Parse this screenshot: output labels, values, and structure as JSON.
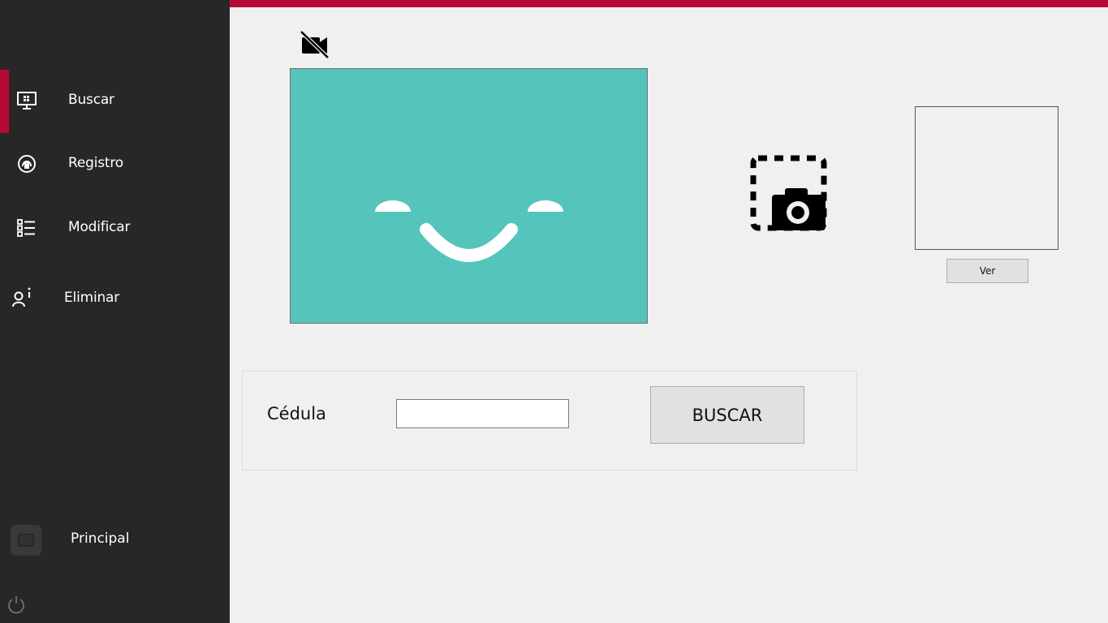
{
  "sidebar": {
    "items": [
      {
        "label": "Buscar",
        "icon": "monitor-icon",
        "active": true
      },
      {
        "label": "Registro",
        "icon": "fingerprint-icon",
        "active": false
      },
      {
        "label": "Modificar",
        "icon": "list-icon",
        "active": false
      },
      {
        "label": "Eliminar",
        "icon": "user-info-icon",
        "active": false
      }
    ],
    "principal_label": "Principal",
    "power_icon": "power-icon"
  },
  "colors": {
    "accent": "#b50a35",
    "sidebar_bg": "#282627",
    "video_bg": "#55c4bb",
    "content_bg": "#f0f0f0"
  },
  "camera": {
    "status_icon": "camera-off-icon",
    "capture_icon": "capture-photo-icon"
  },
  "photo_panel": {
    "view_button_label": "Ver"
  },
  "search": {
    "field_label": "Cédula",
    "input_value": "",
    "button_label": "BUSCAR"
  }
}
